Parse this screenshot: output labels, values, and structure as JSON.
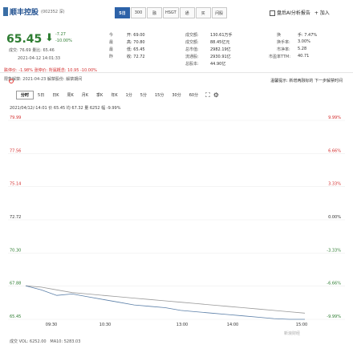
{
  "stock": {
    "name": "顺丰控股",
    "code": "(002352 深)",
    "tabs": [
      "5日",
      "300",
      "融",
      "HSGT",
      "通",
      "买",
      "问股"
    ],
    "right_links": [
      "盘后AI分析报告",
      "+ 加入"
    ]
  },
  "quote": {
    "price": "65.45",
    "arrow": "⬇",
    "change": "-7.27",
    "change_pct": "-10.00%",
    "vol_row": "成交: 76.69  量比: 65.46",
    "date_time": "2021-04-12  14:01:33",
    "fields": [
      [
        "今",
        "开: 69.00"
      ],
      [
        "最",
        "高: 70.80"
      ],
      [
        "最",
        "低: 65.45"
      ],
      [
        "昨",
        "收: 72.72"
      ],
      [
        "成交额:",
        "130.61万手"
      ],
      [
        "成交额:",
        "88.45亿元"
      ],
      [
        "总市值:",
        "2982.19亿"
      ],
      [
        "流通股:",
        "2930.91亿"
      ],
      [
        "总股本:",
        "44.90亿"
      ],
      [
        "换",
        "手: 7.47%"
      ],
      [
        "换手率:",
        "3.00%"
      ],
      [
        "市净率:",
        "5.28"
      ],
      [
        "市盈率TTM:",
        "40.71"
      ]
    ],
    "status_row": "跌停价: -1.98% 涨停价: 所属概念: 10.95 -10.00%",
    "flag": "限售解禁: 2021-04-23 解禁股份: 解禁期间"
  },
  "links": {
    "right": "温馨提示: 新增两融标的   下一步解禁时间"
  },
  "periods": [
    "分时",
    "5日",
    "日K",
    "周K",
    "月K",
    "季K",
    "年K",
    "1分",
    "5分",
    "15分",
    "30分",
    "60分"
  ],
  "chart_info": "2021/04/12/-14:01 价 65.45 均 67.32 量 6252 幅 -9.99%",
  "chart_data": {
    "type": "line",
    "title": "",
    "x": [
      "09:30",
      "10:30",
      "13:00",
      "14:00",
      "15:00"
    ],
    "y_ticks_left": [
      "79.99",
      "77.56",
      "75.14",
      "72.72",
      "70.30",
      "67.88",
      "65.45"
    ],
    "y_ticks_right": [
      "9.99%",
      "6.66%",
      "3.33%",
      "0.00%",
      "-3.33%",
      "-6.66%",
      "-9.99%"
    ],
    "ylim": [
      65.45,
      79.99
    ],
    "series": [
      {
        "values": [
          67.9,
          67.6,
          67.2,
          67.3,
          67.1,
          66.9,
          66.7,
          66.5,
          66.4,
          66.3,
          66.1,
          66.0,
          65.9,
          65.8,
          65.7,
          65.6,
          65.5,
          65.45,
          65.45
        ]
      },
      {
        "values": [
          67.9,
          67.8,
          67.6,
          67.4,
          67.3,
          67.2,
          67.1,
          67.0,
          66.9,
          66.8,
          66.7,
          66.6,
          66.5,
          66.4,
          66.3,
          66.2,
          66.1,
          66.0,
          65.9
        ]
      }
    ],
    "grid": true
  },
  "footer": {
    "volume": "成交 VOL: 6252.00",
    "ma5": "MA10: 5283.03",
    "weibo": "新浪财经"
  },
  "colors": {
    "brand": "#2d62a8",
    "down": "#2e7d32",
    "up": "#d32f2f",
    "line": "#5b7fa8",
    "avg": "#999999"
  }
}
